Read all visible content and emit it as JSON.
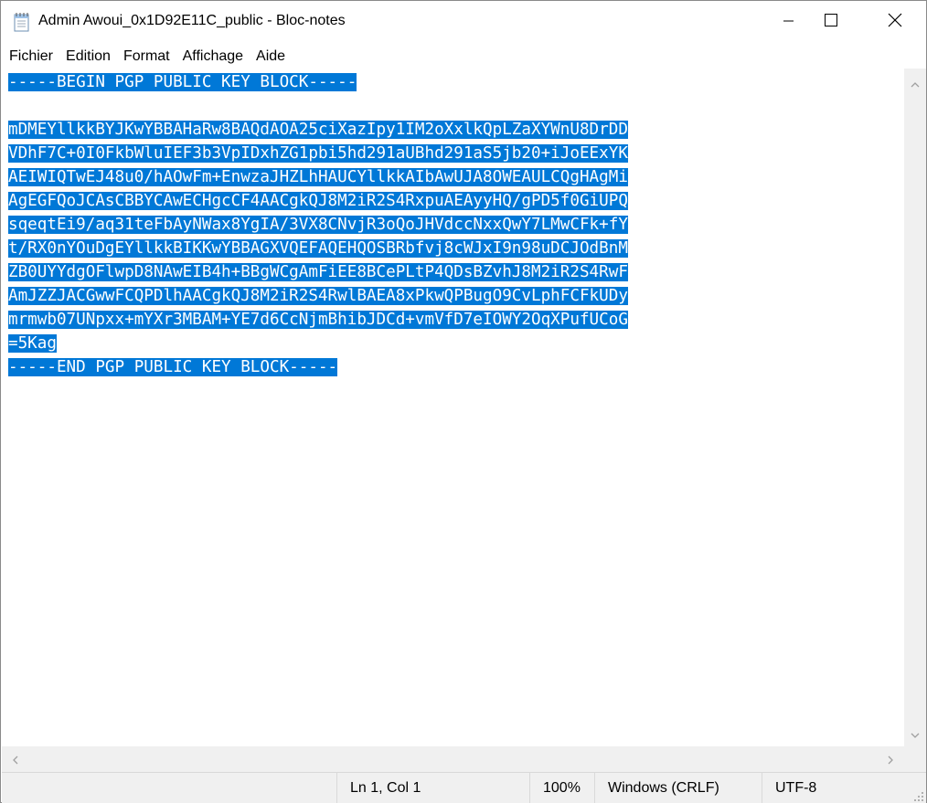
{
  "window": {
    "title": "Admin Awoui_0x1D92E11C_public - Bloc-notes",
    "app_icon": "notepad-icon",
    "controls": [
      "minimize-icon",
      "maximize-icon",
      "close-icon"
    ]
  },
  "menu": [
    "Fichier",
    "Edition",
    "Format",
    "Affichage",
    "Aide"
  ],
  "editor": {
    "selection_color": "#0078d7",
    "lines": [
      "-----BEGIN PGP PUBLIC KEY BLOCK-----",
      "",
      "mDMEYllkkBYJKwYBBAHaRw8BAQdAOA25ciXazIpy1IM2oXxlkQpLZaXYWnU8DrDD",
      "VDhF7C+0I0FkbWluIEF3b3VpIDxhZG1pbi5hd291aUBhd291aS5jb20+iJoEExYK",
      "AEIWIQTwEJ48u0/hAOwFm+EnwzaJHZLhHAUCYllkkAIbAwUJA8OWEAULCQgHAgMi",
      "AgEGFQoJCAsCBBYCAwECHgcCF4AACgkQJ8M2iR2S4RxpuAEAyyHQ/gPD5f0GiUPQ",
      "sqeqtEi9/aq31teFbAyNWax8YgIA/3VX8CNvjR3oQoJHVdccNxxQwY7LMwCFk+fY",
      "t/RX0nYOuDgEYllkkBIKKwYBBAGXVQEFAQEHQOSBRbfvj8cWJxI9n98uDCJOdBnM",
      "ZB0UYYdgOFlwpD8NAwEIB4h+BBgWCgAmFiEE8BCePLtP4QDsBZvhJ8M2iR2S4RwF",
      "AmJZZJACGwwFCQPDlhAACgkQJ8M2iR2S4RwlBAEA8xPkwQPBugO9CvLphFCFkUDy",
      "mrmwb07UNpxx+mYXr3MBAM+YE7d6CcNjmBhibJDCd+vmVfD7eIOWY2OqXPufUCoG",
      "=5Kag",
      "-----END PGP PUBLIC KEY BLOCK-----"
    ]
  },
  "status": {
    "position": "Ln 1, Col 1",
    "zoom": "100%",
    "line_ending": "Windows (CRLF)",
    "encoding": "UTF-8"
  }
}
